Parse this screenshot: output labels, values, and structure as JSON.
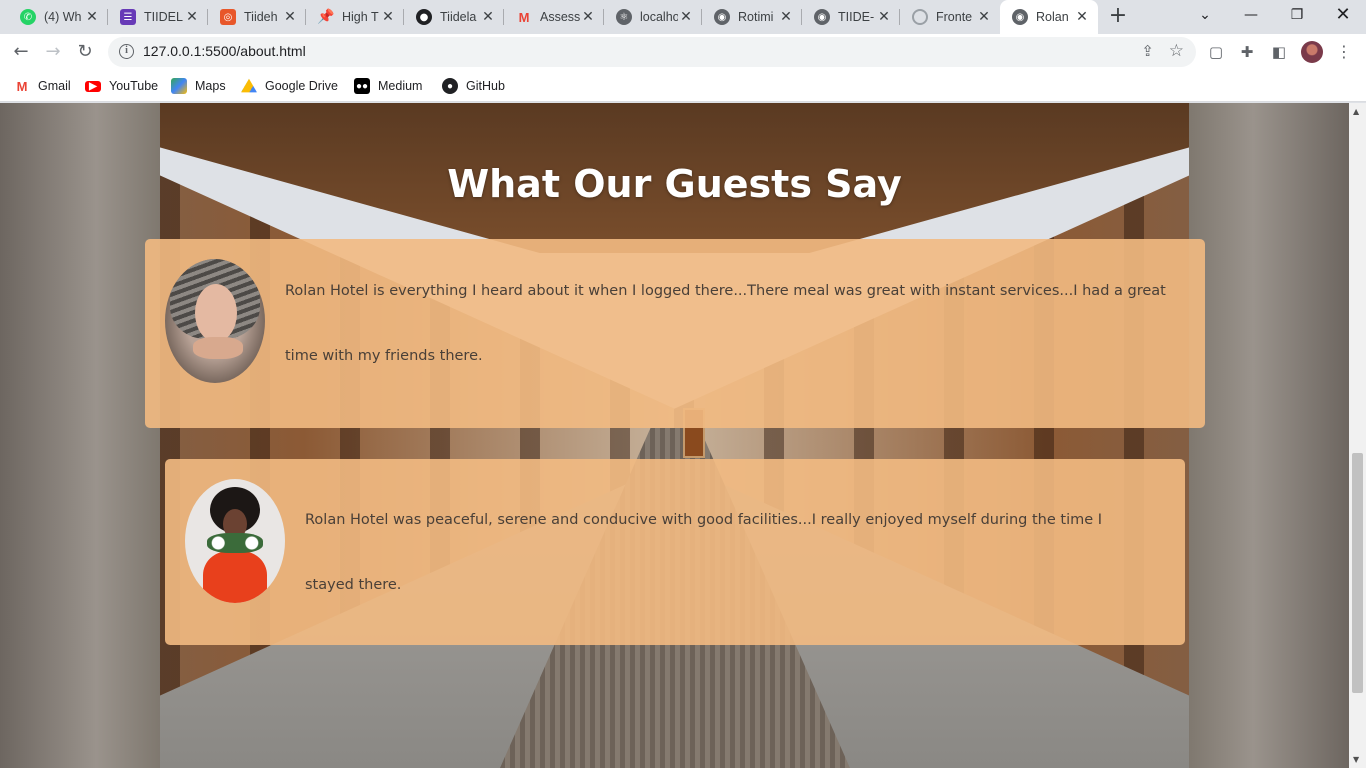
{
  "tabs": [
    {
      "label": "(4) Wh",
      "icon": "whatsapp-icon",
      "color": "#25d366"
    },
    {
      "label": "TIIDEL",
      "icon": "forms-icon",
      "color": "#673ab7"
    },
    {
      "label": "Tiideh",
      "icon": "tiideh-icon",
      "color": "#e8572a"
    },
    {
      "label": "High T",
      "icon": "pin-icon",
      "color": "#e53935"
    },
    {
      "label": "Tiidela",
      "icon": "github-icon",
      "color": "#202124"
    },
    {
      "label": "Assess",
      "icon": "gmail-icon",
      "color": "#ea4335"
    },
    {
      "label": "localho",
      "icon": "react-icon",
      "color": "#5f6368"
    },
    {
      "label": "Rotimi",
      "icon": "globe-icon",
      "color": "#5f6368"
    },
    {
      "label": "TIIDE-",
      "icon": "globe-icon",
      "color": "#5f6368"
    },
    {
      "label": "Fronte",
      "icon": "loading-icon",
      "color": "#9aa0a6"
    },
    {
      "label": "Rolan",
      "icon": "globe-icon",
      "color": "#5f6368",
      "active": true
    }
  ],
  "toolbar": {
    "url": "127.0.0.1:5500/about.html"
  },
  "bookmarks": [
    {
      "label": "Gmail",
      "icon": "gmail-icon",
      "color": "#ea4335"
    },
    {
      "label": "YouTube",
      "icon": "youtube-icon",
      "color": "#ff0000"
    },
    {
      "label": "Maps",
      "icon": "maps-icon",
      "color": "#34a853"
    },
    {
      "label": "Google Drive",
      "icon": "drive-icon",
      "color": "#fbbc04"
    },
    {
      "label": "Medium",
      "icon": "medium-icon",
      "color": "#000000"
    },
    {
      "label": "GitHub",
      "icon": "github-icon",
      "color": "#202124"
    }
  ],
  "page": {
    "heading": "What Our Guests Say",
    "reviews": [
      {
        "text": "Rolan Hotel is everything I heard about it when I logged there...There meal was great with instant services...I had a great time with my friends there."
      },
      {
        "text": "Rolan Hotel was peaceful, serene and conducive with good facilities...I really enjoyed myself during the time I stayed there."
      }
    ]
  },
  "colors": {
    "card_bg": "#f2ba82",
    "heading": "#ffffff",
    "body_text": "#4a4038"
  }
}
